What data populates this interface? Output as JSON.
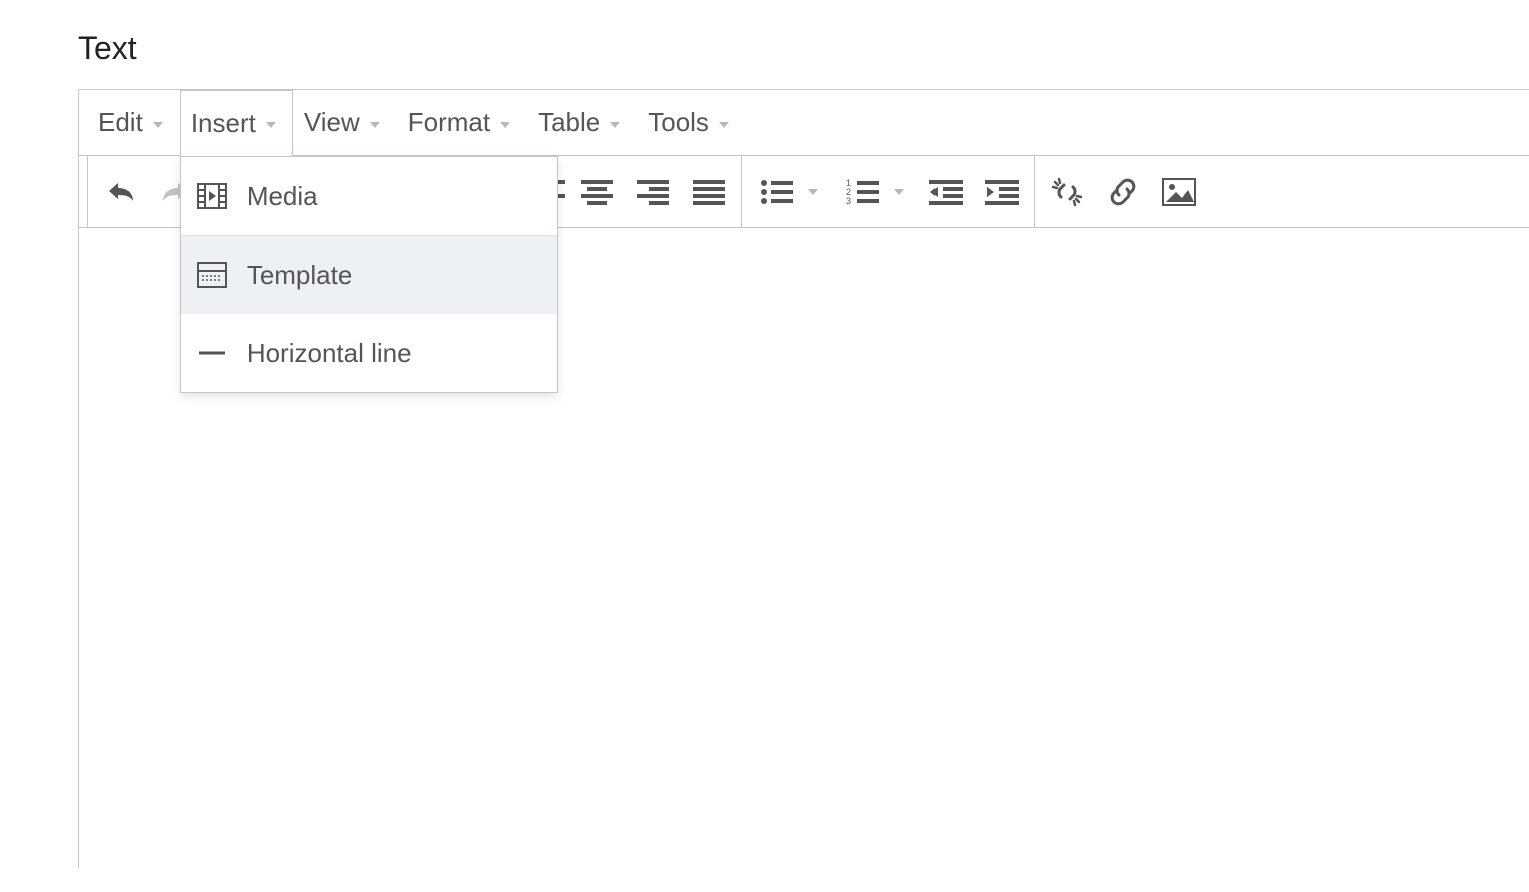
{
  "title": "Text",
  "menubar": {
    "items": [
      {
        "label": "Edit"
      },
      {
        "label": "Insert",
        "open": true
      },
      {
        "label": "View"
      },
      {
        "label": "Format"
      },
      {
        "label": "Table"
      },
      {
        "label": "Tools"
      }
    ]
  },
  "insert_menu": {
    "items": [
      {
        "label": "Media",
        "icon": "media"
      },
      {
        "label": "Template",
        "icon": "template",
        "hover": true
      },
      {
        "label": "Horizontal line",
        "icon": "hr"
      }
    ]
  },
  "toolbar": {
    "groups": [
      [
        {
          "name": "undo",
          "icon": "undo"
        },
        {
          "name": "redo",
          "icon": "redo",
          "disabled": true
        }
      ],
      [
        {
          "name": "align-left",
          "icon": "alignleft"
        },
        {
          "name": "align-center",
          "icon": "aligncenter"
        },
        {
          "name": "align-right",
          "icon": "alignright"
        },
        {
          "name": "align-justify",
          "icon": "alignjustify"
        }
      ],
      [
        {
          "name": "bullet-list",
          "icon": "bullets",
          "split": true
        },
        {
          "name": "number-list",
          "icon": "numbers",
          "split": true
        },
        {
          "name": "outdent",
          "icon": "outdent"
        },
        {
          "name": "indent",
          "icon": "indent"
        }
      ],
      [
        {
          "name": "unlink",
          "icon": "unlink"
        },
        {
          "name": "link",
          "icon": "link"
        },
        {
          "name": "image",
          "icon": "image"
        }
      ]
    ]
  }
}
